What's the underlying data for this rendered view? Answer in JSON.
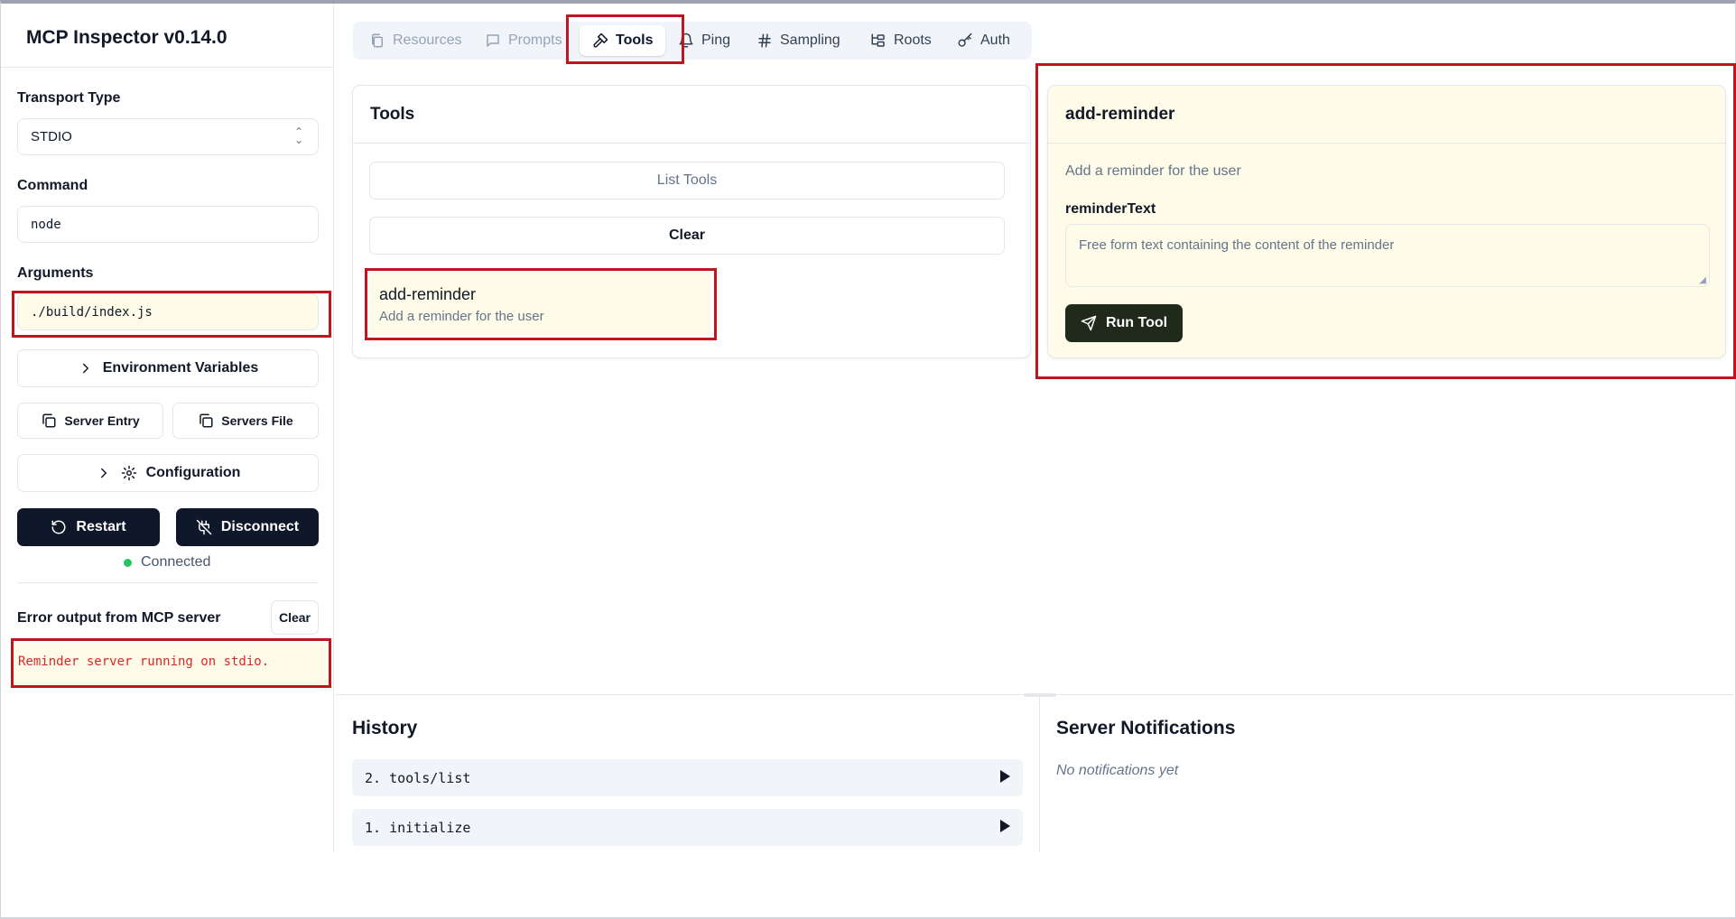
{
  "app": {
    "title": "MCP Inspector v0.14.0"
  },
  "sidebar": {
    "transport_label": "Transport Type",
    "transport_value": "STDIO",
    "command_label": "Command",
    "command_value": "node",
    "arguments_label": "Arguments",
    "arguments_value": "./build/index.js",
    "env_vars_label": "Environment Variables",
    "server_entry_label": "Server Entry",
    "servers_file_label": "Servers File",
    "configuration_label": "Configuration",
    "restart_label": "Restart",
    "disconnect_label": "Disconnect",
    "status_text": "Connected",
    "error_output_label": "Error output from MCP server",
    "error_clear_label": "Clear",
    "error_output_text": "Reminder server running on stdio."
  },
  "tabs": [
    {
      "label": "Resources",
      "icon": "files-icon",
      "state": "disabled"
    },
    {
      "label": "Prompts",
      "icon": "message-square-icon",
      "state": "disabled"
    },
    {
      "label": "Tools",
      "icon": "hammer-icon",
      "state": "active"
    },
    {
      "label": "Ping",
      "icon": "bell-icon",
      "state": "normal"
    },
    {
      "label": "Sampling",
      "icon": "hash-icon",
      "state": "normal"
    },
    {
      "label": "Roots",
      "icon": "folder-tree-icon",
      "state": "normal"
    },
    {
      "label": "Auth",
      "icon": "key-icon",
      "state": "normal"
    }
  ],
  "tools_panel": {
    "title": "Tools",
    "list_tools_label": "List Tools",
    "clear_label": "Clear",
    "items": [
      {
        "name": "add-reminder",
        "description": "Add a reminder for the user"
      }
    ]
  },
  "tool_detail": {
    "title": "add-reminder",
    "description": "Add a reminder for the user",
    "param_label": "reminderText",
    "param_placeholder": "Free form text containing the content of the reminder",
    "run_label": "Run Tool"
  },
  "history": {
    "title": "History",
    "items": [
      {
        "label": "2. tools/list"
      },
      {
        "label": "1. initialize"
      }
    ]
  },
  "notifications": {
    "title": "Server Notifications",
    "empty_text": "No notifications yet"
  },
  "colors": {
    "highlight": "#fefce8",
    "annotation_red": "#c0141e",
    "dark_button": "#0f172a",
    "connected_green": "#22c55e",
    "error_text": "#dc2626"
  }
}
